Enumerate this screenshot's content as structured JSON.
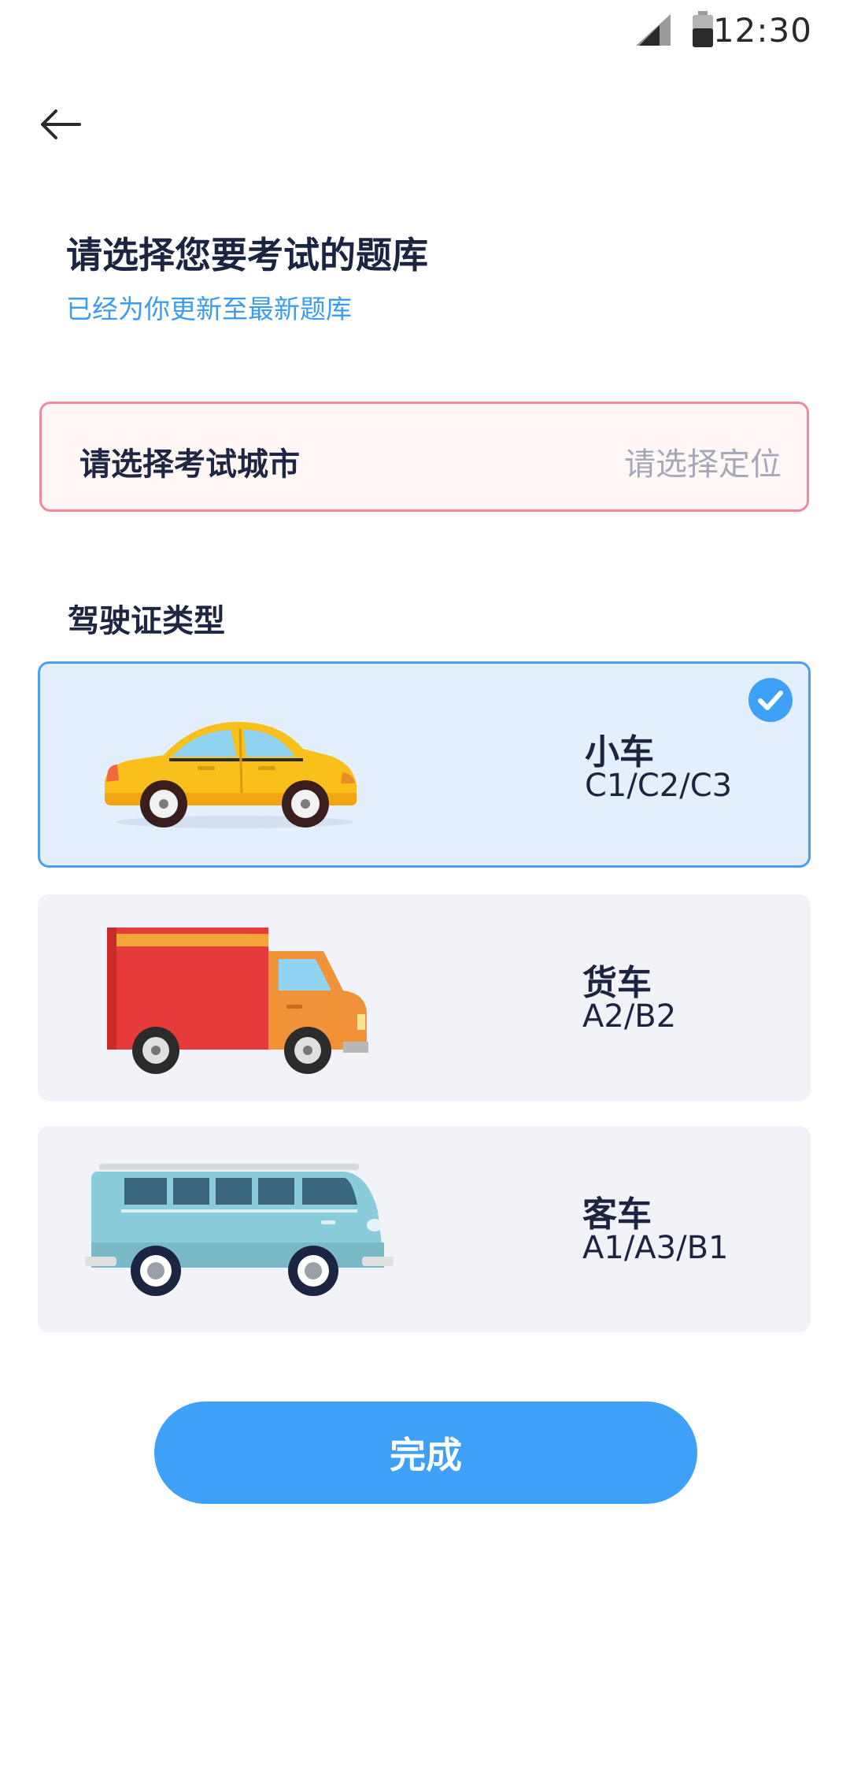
{
  "status_bar": {
    "time": "12:30",
    "icons": [
      "signal-icon",
      "battery-icon"
    ]
  },
  "nav": {
    "back_icon": "back-arrow-icon"
  },
  "header": {
    "title": "请选择您要考试的题库",
    "subtitle": "已经为你更新至最新题库"
  },
  "city": {
    "label": "请选择考试城市",
    "placeholder": "请选择定位"
  },
  "license": {
    "section_title": "驾驶证类型",
    "options": [
      {
        "name": "小车",
        "codes": "C1/C2/C3",
        "icon": "car-icon",
        "selected": true
      },
      {
        "name": "货车",
        "codes": "A2/B2",
        "icon": "truck-icon",
        "selected": false
      },
      {
        "name": "客车",
        "codes": "A1/A3/B1",
        "icon": "bus-icon",
        "selected": false
      }
    ]
  },
  "footer": {
    "done_label": "完成"
  },
  "colors": {
    "accent": "#3fa0f7",
    "subtitle": "#3b9cf0",
    "selected_bg": "#e3effd",
    "selected_border": "#4a9ff0",
    "card_bg": "#f2f3f9",
    "city_border": "#ef8a9a",
    "city_bg": "#fff6f6"
  }
}
